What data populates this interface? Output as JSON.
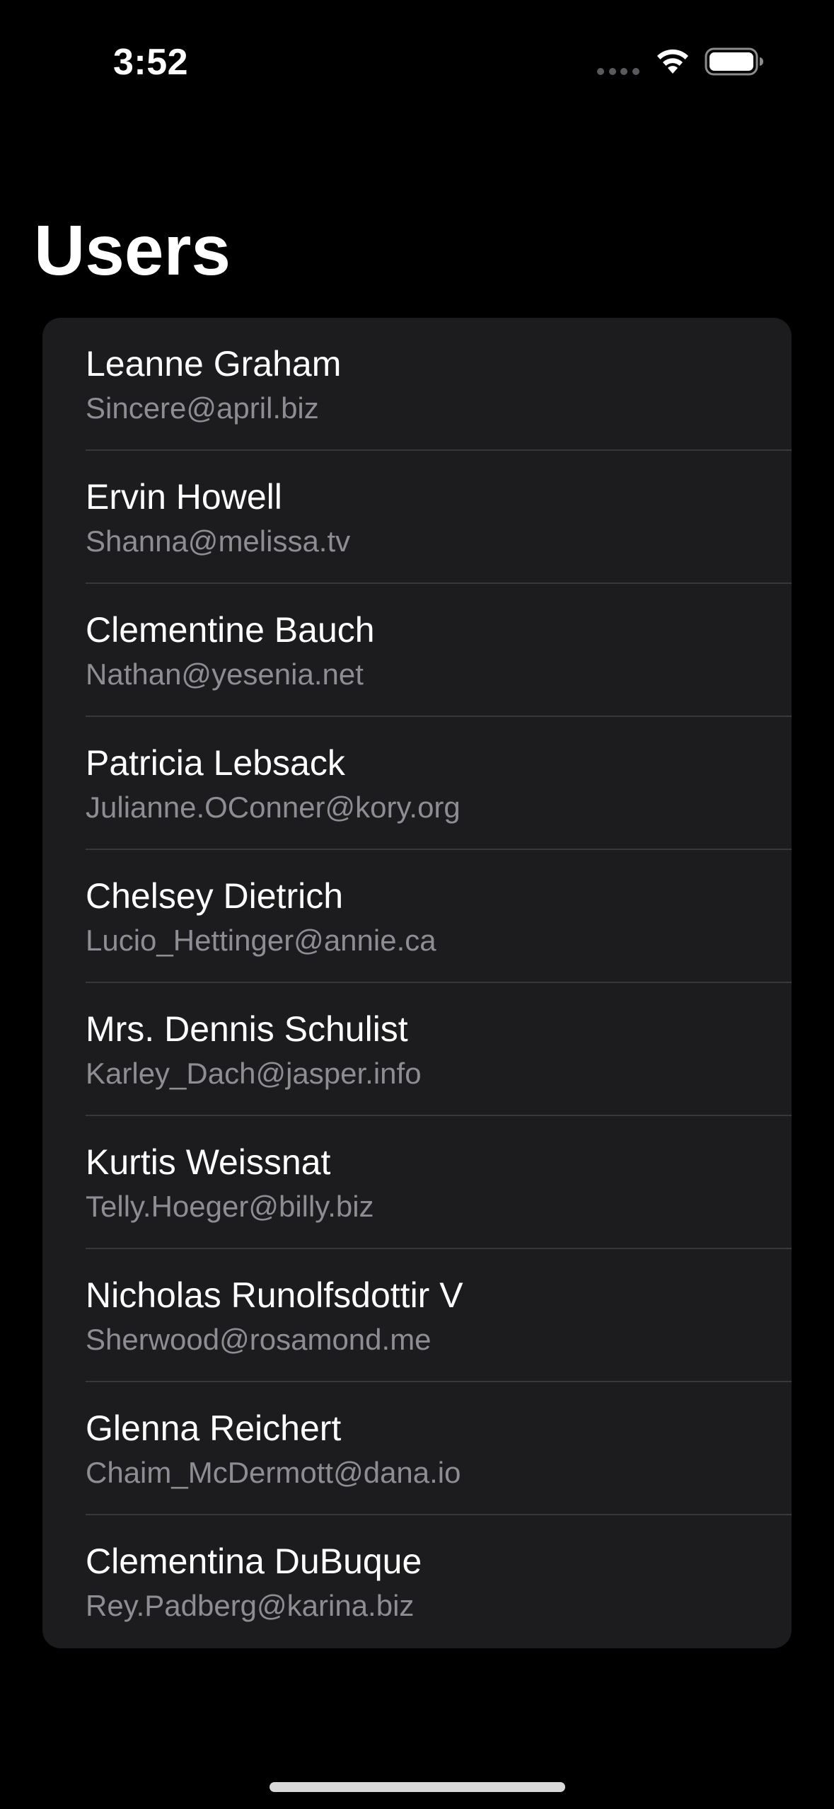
{
  "status_bar": {
    "time": "3:52",
    "signal_icon": "cellular-dots-icon",
    "wifi_icon": "wifi-icon",
    "battery_icon": "battery-full-icon"
  },
  "header": {
    "title": "Users"
  },
  "users": [
    {
      "name": "Leanne Graham",
      "email": "Sincere@april.biz"
    },
    {
      "name": "Ervin Howell",
      "email": "Shanna@melissa.tv"
    },
    {
      "name": "Clementine Bauch",
      "email": "Nathan@yesenia.net"
    },
    {
      "name": "Patricia Lebsack",
      "email": "Julianne.OConner@kory.org"
    },
    {
      "name": "Chelsey Dietrich",
      "email": "Lucio_Hettinger@annie.ca"
    },
    {
      "name": "Mrs. Dennis Schulist",
      "email": "Karley_Dach@jasper.info"
    },
    {
      "name": "Kurtis Weissnat",
      "email": "Telly.Hoeger@billy.biz"
    },
    {
      "name": "Nicholas Runolfsdottir V",
      "email": "Sherwood@rosamond.me"
    },
    {
      "name": "Glenna Reichert",
      "email": "Chaim_McDermott@dana.io"
    },
    {
      "name": "Clementina DuBuque",
      "email": "Rey.Padberg@karina.biz"
    }
  ],
  "colors": {
    "background": "#000000",
    "card": "#1c1c1e",
    "separator": "#38383a",
    "primary_text": "#ffffff",
    "secondary_text": "#8d8d93"
  }
}
